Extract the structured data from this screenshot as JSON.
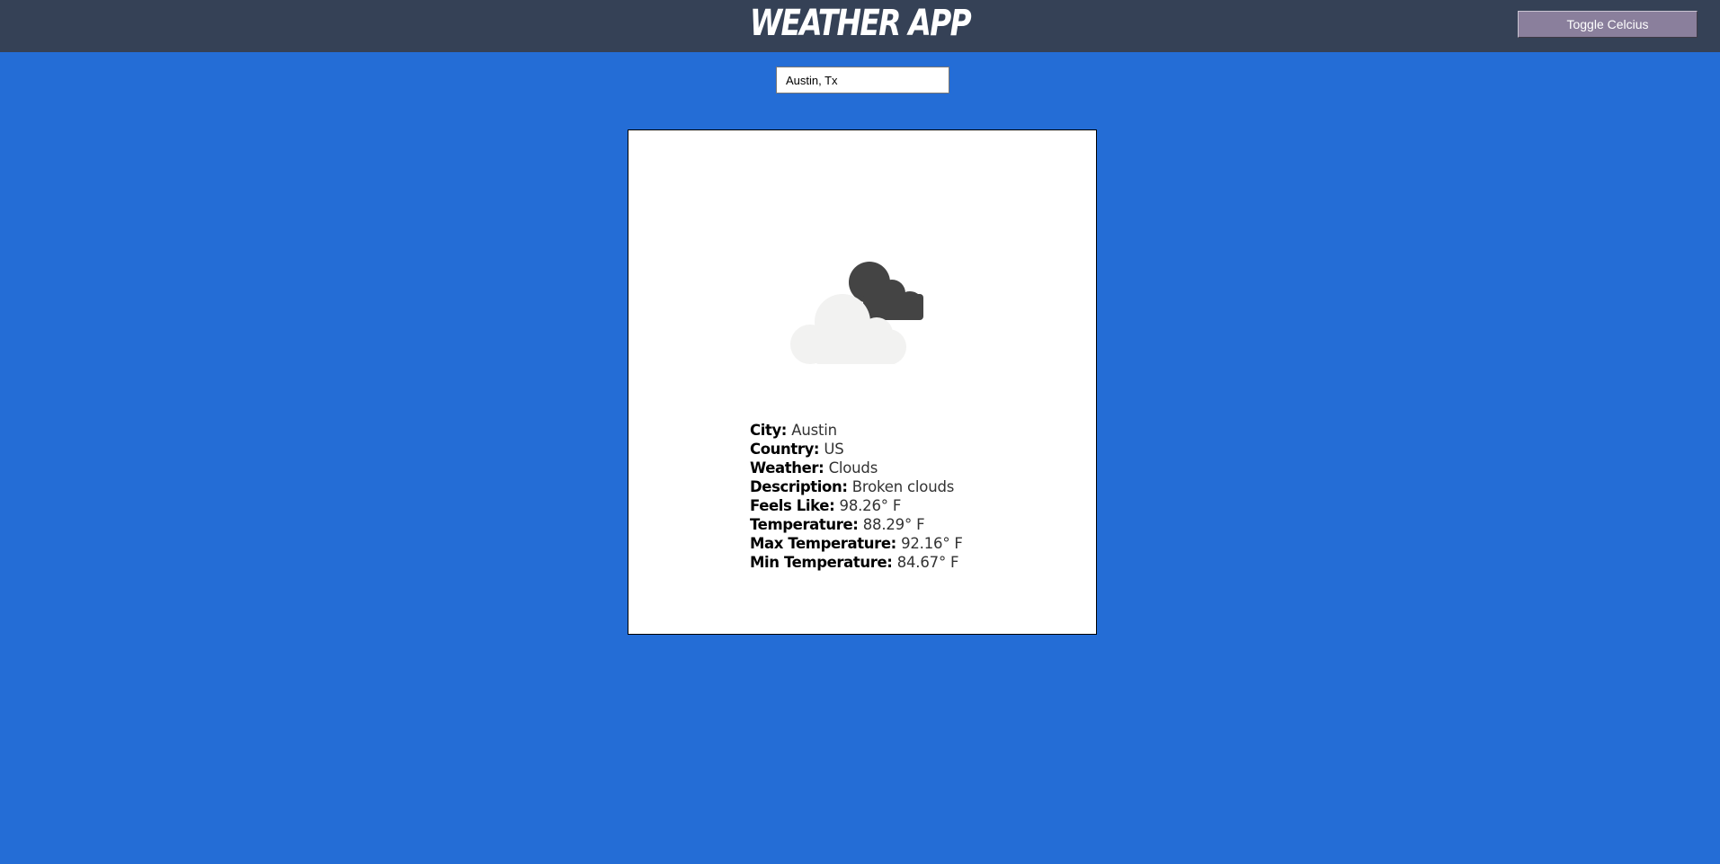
{
  "header": {
    "title": "WEATHER APP",
    "toggle_label": "Toggle Celcius"
  },
  "search": {
    "value": "Austin, Tx"
  },
  "weather": {
    "icon": "broken-clouds-icon",
    "rows": [
      {
        "label": "City:",
        "value": "Austin"
      },
      {
        "label": "Country:",
        "value": "US"
      },
      {
        "label": "Weather:",
        "value": "Clouds"
      },
      {
        "label": "Description:",
        "value": "Broken clouds"
      },
      {
        "label": "Feels Like:",
        "value": "98.26° F"
      },
      {
        "label": "Temperature:",
        "value": "88.29° F"
      },
      {
        "label": "Max Temperature:",
        "value": "92.16° F"
      },
      {
        "label": "Min Temperature:",
        "value": "84.67° F"
      }
    ]
  },
  "colors": {
    "background": "#246dd6",
    "header": "#354156",
    "button": "#8a7f9c",
    "card": "#ffffff",
    "cloud_front": "#f2f2f1",
    "cloud_back": "#444444"
  }
}
